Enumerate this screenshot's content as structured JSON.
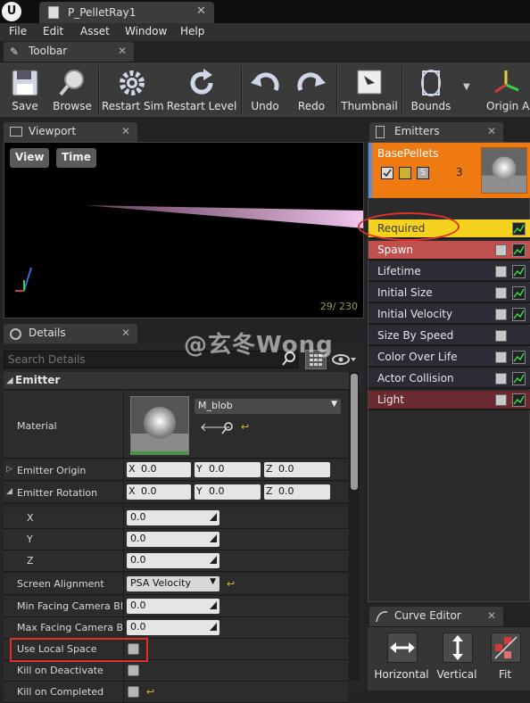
{
  "window": {
    "tab_title": "P_PelletRay1"
  },
  "menu": [
    "File",
    "Edit",
    "Asset",
    "Window",
    "Help"
  ],
  "toolbar": {
    "tab_label": "Toolbar",
    "buttons": [
      "Save",
      "Browse",
      "Restart Sim",
      "Restart Level",
      "Undo",
      "Redo",
      "Thumbnail",
      "Bounds",
      "Origin Axis"
    ]
  },
  "viewport": {
    "tab_label": "Viewport",
    "view_button": "View",
    "time_button": "Time",
    "frame_counter": "29/ 230"
  },
  "details": {
    "tab_label": "Details",
    "search_placeholder": "Search Details",
    "category": "Emitter",
    "material_label": "Material",
    "material_value": "M_blob",
    "emitter_origin_label": "Emitter Origin",
    "emitter_rotation_label": "Emitter Rotation",
    "origin": {
      "x": "0.0",
      "y": "0.0",
      "z": "0.0"
    },
    "rotation": {
      "x": "0.0",
      "y": "0.0",
      "z": "0.0"
    },
    "axis_letters": {
      "x": "X",
      "y": "Y",
      "z": "Z"
    },
    "rot_x_label": "X",
    "rot_y_label": "Y",
    "rot_z_label": "Z",
    "rot_x_value": "0.0",
    "rot_y_value": "0.0",
    "rot_z_value": "0.0",
    "screen_alignment_label": "Screen Alignment",
    "screen_alignment_value": "PSA Velocity",
    "min_facing_label": "Min Facing Camera Blend Distance",
    "min_facing_value": "0.0",
    "max_facing_label": "Max Facing Camera Blend Distance",
    "max_facing_value": "0.0",
    "use_local_space_label": "Use Local Space",
    "use_local_space_checked": false,
    "kill_on_deactivate_label": "Kill on Deactivate",
    "kill_on_completed_label": "Kill on Completed"
  },
  "emitters": {
    "tab_label": "Emitters",
    "name": "BasePellets",
    "count": "3",
    "modules": [
      "Required",
      "Spawn",
      "Lifetime",
      "Initial Size",
      "Initial Velocity",
      "Size By Speed",
      "Color Over Life",
      "Actor Collision",
      "Light"
    ]
  },
  "curve_editor": {
    "tab_label": "Curve Editor",
    "buttons": [
      "Horizontal",
      "Vertical",
      "Fit"
    ]
  },
  "watermark": "@玄冬Wong",
  "colors": {
    "accent_orange": "#f07a12",
    "required_yellow": "#f4d21e",
    "spawn_red": "#c0504d",
    "light_maroon": "#6b2a30",
    "annotation_red": "#e0302a"
  }
}
